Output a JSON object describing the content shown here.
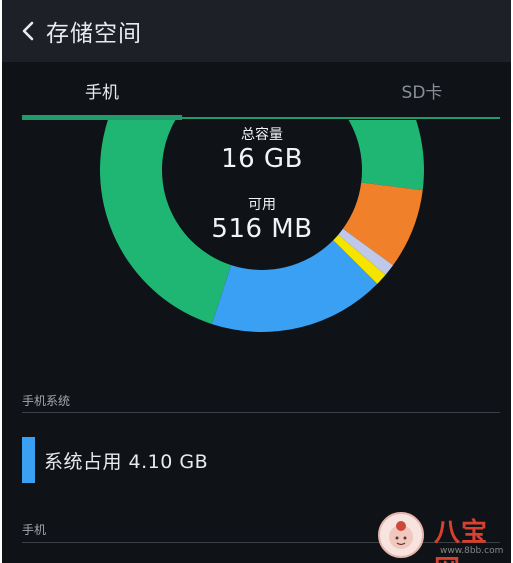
{
  "appbar": {
    "title": "存储空间",
    "back_icon": "chevron-left-icon"
  },
  "tabs": [
    {
      "label": "手机",
      "selected": true
    },
    {
      "label": "SD卡",
      "selected": false
    }
  ],
  "storage": {
    "total_label": "总容量",
    "total_value": "16 GB",
    "available_label": "可用",
    "available_value": "516 MB"
  },
  "donut_segments": [
    {
      "color": "#1fb573",
      "fraction": 0.72
    },
    {
      "color": "#f0812a",
      "fraction": 0.08
    },
    {
      "color": "#bfc8e8",
      "fraction": 0.012
    },
    {
      "color": "#f4e400",
      "fraction": 0.012
    },
    {
      "color": "#3aa0f3",
      "fraction": 0.176
    }
  ],
  "sections": [
    {
      "title": "手机系统"
    },
    {
      "title": "手机"
    }
  ],
  "legend": [
    {
      "label": "系统占用 4.10 GB",
      "color": "#3aa0f3"
    }
  ],
  "watermark": {
    "text": "八宝网",
    "url": "www.8bb.com"
  }
}
